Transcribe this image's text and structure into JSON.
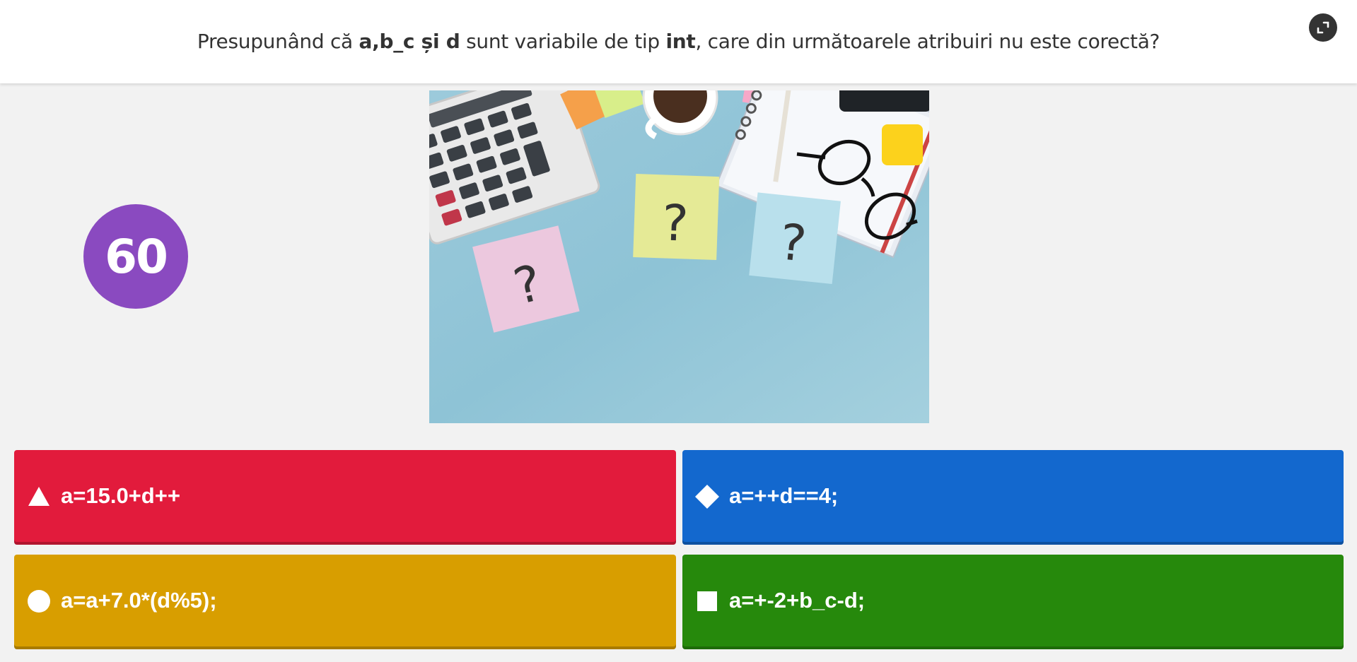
{
  "question": {
    "parts": [
      {
        "text": "Presupunând că ",
        "bold": false
      },
      {
        "text": "a,b_c și d",
        "bold": true
      },
      {
        "text": " sunt variabile de tip ",
        "bold": false
      },
      {
        "text": "int",
        "bold": true
      },
      {
        "text": ", care din următoarele atribuiri nu este corectă?",
        "bold": false
      }
    ]
  },
  "timer": {
    "value": "60",
    "color": "#8a4ac0"
  },
  "fullscreen": {
    "icon": "fullscreen-icon"
  },
  "media": {
    "icon": "question-photo",
    "description_icon": "desk-with-question-notes"
  },
  "answers": [
    {
      "label": "a=15.0+d++",
      "shape": "triangle-icon",
      "color": "#e21b3c"
    },
    {
      "label": "a=++d==4;",
      "shape": "diamond-icon",
      "color": "#1368ce"
    },
    {
      "label": "a=a+7.0*(d%5);",
      "shape": "circle-icon",
      "color": "#d89e00"
    },
    {
      "label": "a=+-2+b_c-d;",
      "shape": "square-icon",
      "color": "#26890c"
    }
  ]
}
